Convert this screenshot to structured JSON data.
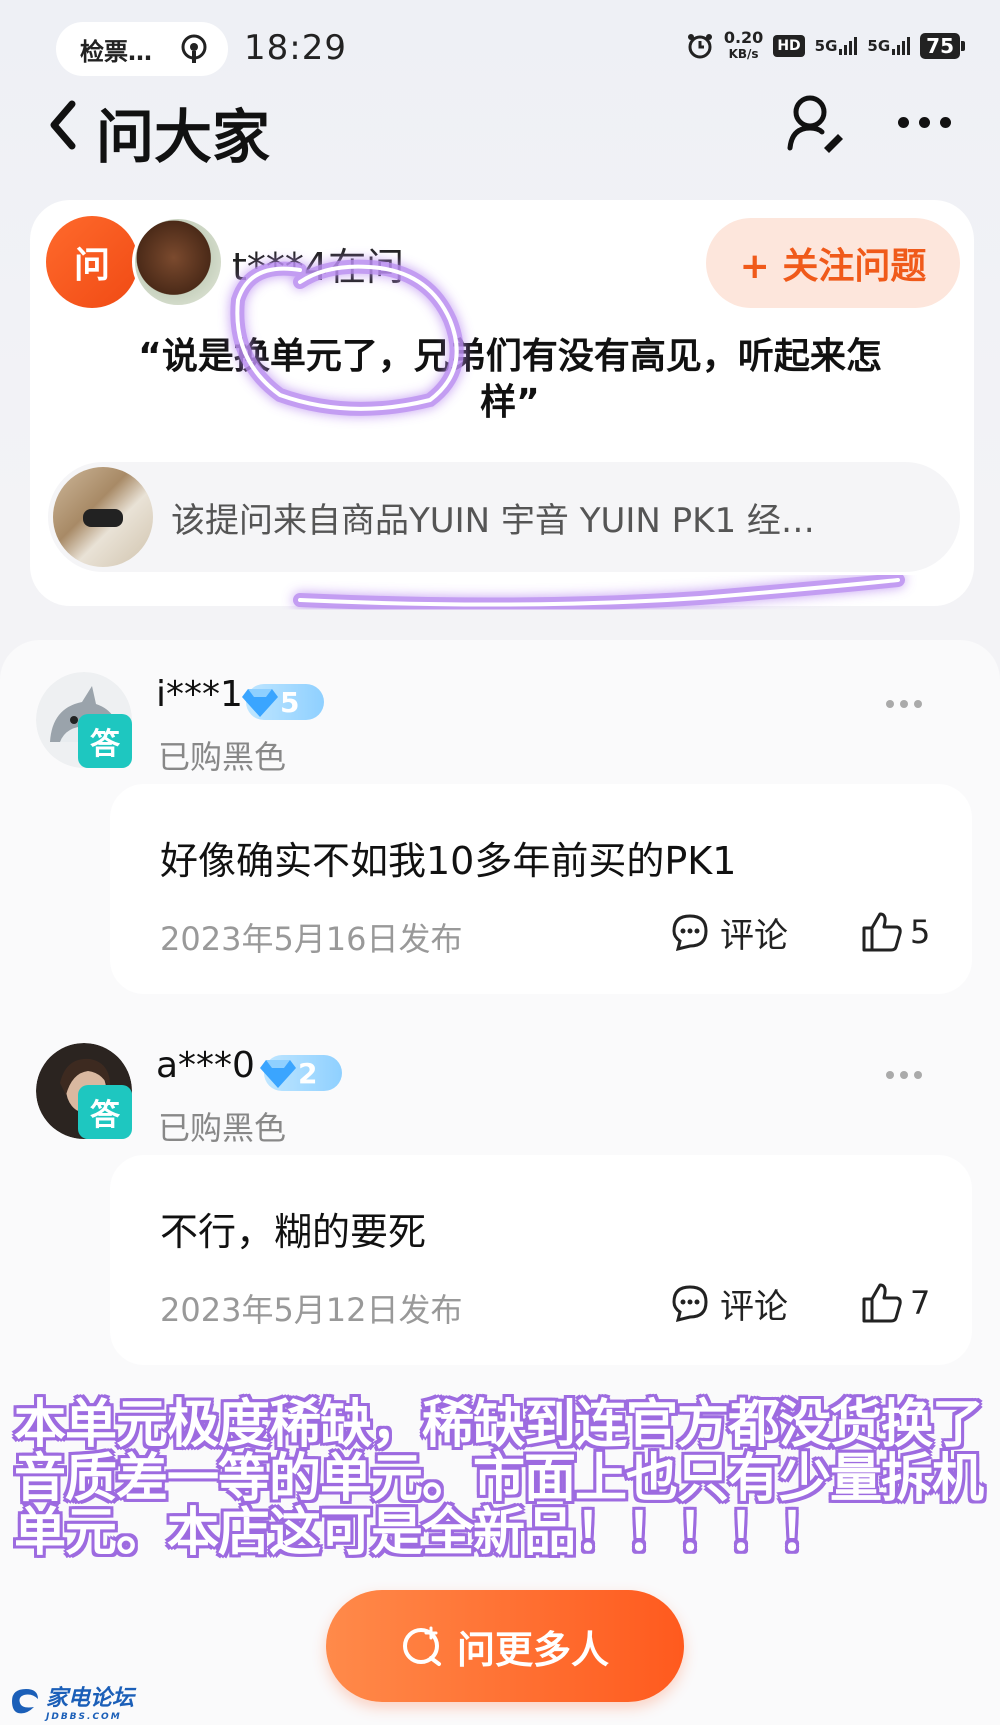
{
  "status_bar": {
    "ticket_label": "检票…",
    "time": "18:29",
    "net_speed_value": "0.20",
    "net_speed_unit": "KB/s",
    "hd_label": "HD",
    "signal1_label": "5G",
    "signal2_label": "5G",
    "battery": "75"
  },
  "header": {
    "title": "问大家",
    "back_icon": "chevron-left-icon",
    "search_user_icon": "user-search-icon",
    "more_icon": "more-icon"
  },
  "question": {
    "ask_badge": "问",
    "asker": "t***4在问",
    "follow_label": "+ 关注问题",
    "text": "“说是换单元了，兄弟们有没有高见，听起来怎样”",
    "product_text": "该提问来自商品YUIN 宇音 YUIN PK1 经…"
  },
  "answers": [
    {
      "user": "i***1",
      "level": "5",
      "tag": "答",
      "purchase": "已购黑色",
      "content": "好像确实不如我10多年前买的PK1",
      "date": "2023年5月16日发布",
      "comment_label": "评论",
      "likes": "5"
    },
    {
      "user": "a***0",
      "level": "2",
      "tag": "答",
      "purchase": "已购黑色",
      "content": "不行，糊的要死",
      "date": "2023年5月12日发布",
      "comment_label": "评论",
      "likes": "7"
    }
  ],
  "promo": {
    "text": "本单元极度稀缺，稀缺到连官方都没货换了音质差一等的单元。市面上也只有少量拆机单元。本店这可是全新品！！！！！"
  },
  "bottom": {
    "ask_more_label": "问更多人"
  },
  "watermark": {
    "name": "家电论坛",
    "domain": "JDBBS.COM"
  },
  "colors": {
    "accent": "#f05a1a",
    "answer_tag": "#1ec7c0",
    "annotation": "#b98cf0"
  }
}
